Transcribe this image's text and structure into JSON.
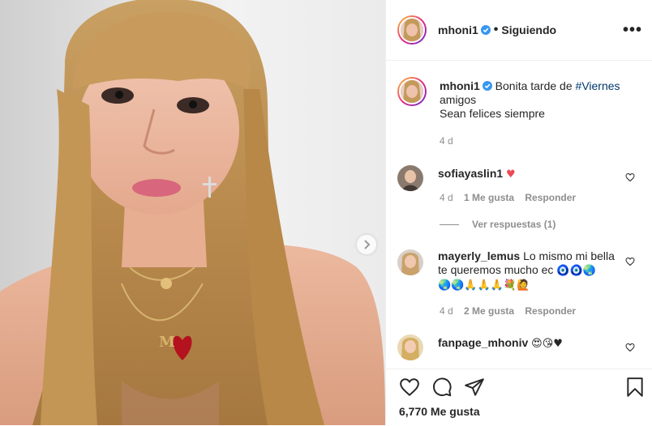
{
  "post": {
    "username": "mhoni1",
    "follow_separator": "•",
    "follow_status": "Siguiendo",
    "more_icon": "•••",
    "caption_before": "Bonita tarde de ",
    "caption_hashtag": "#Viernes",
    "caption_line2": "amigos",
    "caption_line3": "Sean felices siempre",
    "time": "4 d"
  },
  "comments": [
    {
      "username": "sofiayaslin1",
      "text": "♥",
      "time": "4 d",
      "likes": "1 Me gusta",
      "reply": "Responder",
      "view_replies": "Ver respuestas (1)"
    },
    {
      "username": "mayerly_lemus",
      "text_line1": "Lo mismo mi bella",
      "text_line2": "te queremos mucho ec",
      "text_emoji1": "🧿🧿🌏",
      "text_emoji2": "🌏🌏🙏🙏🙏💐🙋",
      "time": "4 d",
      "likes": "2 Me gusta",
      "reply": "Responder"
    },
    {
      "username": "fanpage_mhoniv",
      "text": "😍😘♥"
    }
  ],
  "footer": {
    "likes": "6,770 Me gusta"
  },
  "colors": {
    "verified": "#3897f0",
    "heart_red": "#ed4956",
    "link": "#00376b",
    "muted": "#8e8e8e"
  }
}
